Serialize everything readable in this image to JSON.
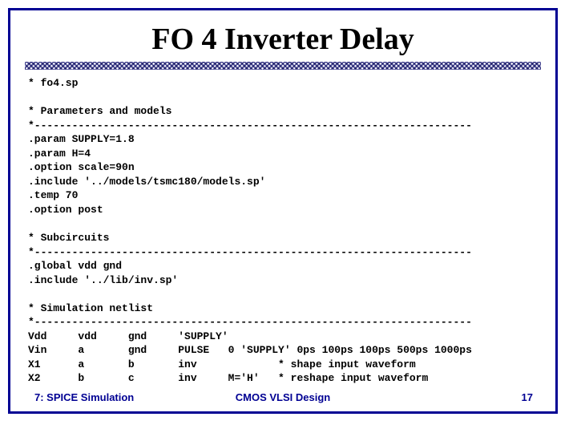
{
  "title": "FO 4 Inverter Delay",
  "code": "* fo4.sp\n\n* Parameters and models\n*----------------------------------------------------------------------\n.param SUPPLY=1.8\n.param H=4\n.option scale=90n\n.include '../models/tsmc180/models.sp'\n.temp 70\n.option post\n\n* Subcircuits\n*----------------------------------------------------------------------\n.global vdd gnd\n.include '../lib/inv.sp'\n\n* Simulation netlist\n*----------------------------------------------------------------------\nVdd     vdd     gnd     'SUPPLY'\nVin     a       gnd     PULSE   0 'SUPPLY' 0ps 100ps 100ps 500ps 1000ps\nX1      a       b       inv             * shape input waveform\nX2      b       c       inv     M='H'   * reshape input waveform",
  "footer": {
    "left": "7: SPICE Simulation",
    "center": "CMOS VLSI Design",
    "right": "17"
  }
}
